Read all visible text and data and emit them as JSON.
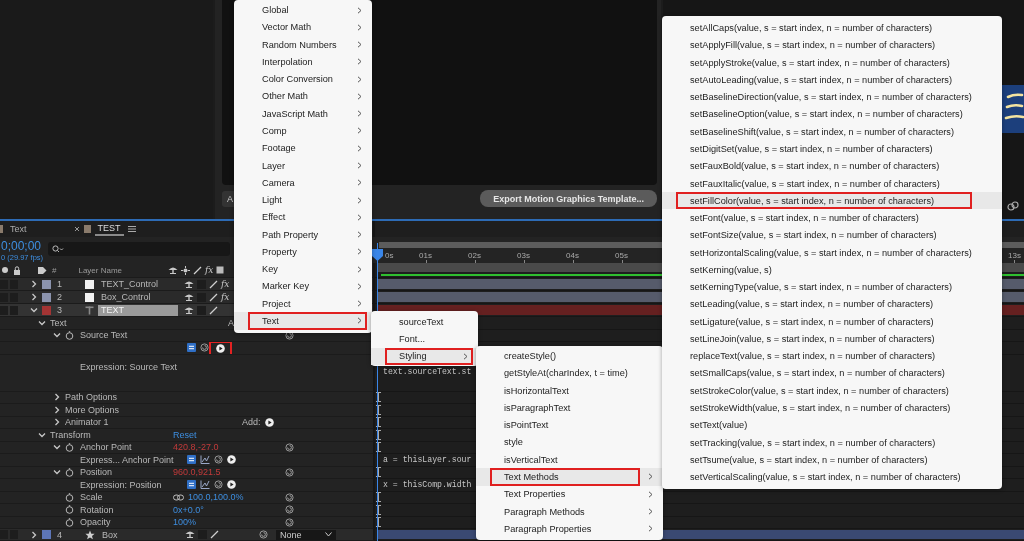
{
  "composition_panel": {
    "partial_button": "A",
    "export_button": "Export Motion Graphics Template..."
  },
  "timeline": {
    "tabs": [
      {
        "label": "Text",
        "selected": false,
        "closable": false
      },
      {
        "label": "TEST",
        "selected": true,
        "closable": true
      }
    ],
    "timecode": "0;00;00",
    "frame_rate": "0 (29.97 fps)",
    "columns": {
      "number": "#",
      "layer_name": "Layer Name",
      "effects": "fx"
    },
    "ruler": [
      "0s",
      "01s",
      "02s",
      "03s",
      "04s",
      "05s",
      "13s"
    ],
    "layers": [
      {
        "number": "1",
        "name": "TEXT_Control",
        "kind": "solid",
        "color": "#8b93ad",
        "selected": false,
        "expanded": false,
        "effects": "fx"
      },
      {
        "number": "2",
        "name": "Box_Control",
        "kind": "solid",
        "color": "#8b93ad",
        "selected": false,
        "expanded": false,
        "effects": "fx"
      },
      {
        "number": "3",
        "name": "TEXT",
        "kind": "text",
        "color": "#a33434",
        "selected": true,
        "expanded": true,
        "children": [
          {
            "label": "Text",
            "kind": "group",
            "expanded": true,
            "add_label": "A",
            "keyframe_marker": false,
            "children": [
              {
                "label": "Source Text",
                "kind": "property",
                "expanded": true,
                "keyframe_marker": false,
                "children": [
                  {
                    "label": "Expression: Source Text",
                    "kind": "expression_block",
                    "graph_button": false,
                    "annotated": true,
                    "code": "text.sourceText.st"
                  }
                ]
              },
              {
                "label": "Path Options",
                "kind": "group",
                "expanded": false,
                "keyframe_marker": true
              },
              {
                "label": "More Options",
                "kind": "group",
                "expanded": false,
                "keyframe_marker": true
              },
              {
                "label": "Animator 1",
                "kind": "group",
                "expanded": false,
                "add_label": "Add:",
                "keyframe_marker": true
              }
            ]
          },
          {
            "label": "Transform",
            "kind": "group",
            "expanded": true,
            "reset_link": "Reset",
            "keyframe_marker": true,
            "children": [
              {
                "label": "Anchor Point",
                "kind": "property",
                "expanded": true,
                "value": "420.8,-27.0",
                "has_expression": true,
                "keyframe_marker": true,
                "children": [
                  {
                    "label": "Express... Anchor Point",
                    "kind": "expression",
                    "graph_button": true,
                    "annotated": false,
                    "code": "a = thisLayer.sour"
                  }
                ]
              },
              {
                "label": "Position",
                "kind": "property",
                "expanded": true,
                "value": "960.0,921.5",
                "has_expression": true,
                "keyframe_marker": true,
                "children": [
                  {
                    "label": "Expression: Position",
                    "kind": "expression",
                    "graph_button": true,
                    "annotated": false,
                    "code": "x = thisComp.width"
                  }
                ]
              },
              {
                "label": "Scale",
                "kind": "property",
                "value": "100.0,100.0%",
                "has_expression": false,
                "linked": true,
                "keyframe_marker": true
              },
              {
                "label": "Rotation",
                "kind": "property",
                "value": "0x+0.0°",
                "has_expression": false,
                "keyframe_marker": true
              },
              {
                "label": "Opacity",
                "kind": "property",
                "value": "100%",
                "has_expression": false,
                "keyframe_marker": true
              }
            ]
          }
        ]
      },
      {
        "number": "4",
        "name": "Box",
        "kind": "shape",
        "color": "#5d76b8",
        "selected": false,
        "expanded": false,
        "parent": "None"
      }
    ]
  },
  "menus": [
    {
      "items": [
        {
          "label": "Global",
          "submenu": true,
          "selected": false
        },
        {
          "label": "Vector Math",
          "submenu": true,
          "selected": false
        },
        {
          "label": "Random Numbers",
          "submenu": true,
          "selected": false
        },
        {
          "label": "Interpolation",
          "submenu": true,
          "selected": false
        },
        {
          "label": "Color Conversion",
          "submenu": true,
          "selected": false
        },
        {
          "label": "Other Math",
          "submenu": true,
          "selected": false
        },
        {
          "label": "JavaScript Math",
          "submenu": true,
          "selected": false
        },
        {
          "label": "Comp",
          "submenu": true,
          "selected": false
        },
        {
          "label": "Footage",
          "submenu": true,
          "selected": false
        },
        {
          "label": "Layer",
          "submenu": true,
          "selected": false
        },
        {
          "label": "Camera",
          "submenu": true,
          "selected": false
        },
        {
          "label": "Light",
          "submenu": true,
          "selected": false
        },
        {
          "label": "Effect",
          "submenu": true,
          "selected": false
        },
        {
          "label": "Path Property",
          "submenu": true,
          "selected": false
        },
        {
          "label": "Property",
          "submenu": true,
          "selected": false
        },
        {
          "label": "Key",
          "submenu": true,
          "selected": false
        },
        {
          "label": "Marker Key",
          "submenu": true,
          "selected": false
        },
        {
          "label": "Project",
          "submenu": true,
          "selected": false
        },
        {
          "label": "Text",
          "submenu": true,
          "selected": true
        }
      ]
    },
    {
      "items": [
        {
          "label": "sourceText",
          "submenu": false,
          "selected": false
        },
        {
          "label": "Font...",
          "submenu": false,
          "selected": false
        },
        {
          "label": "Styling",
          "submenu": true,
          "selected": true
        }
      ]
    },
    {
      "items": [
        {
          "label": "createStyle()",
          "submenu": false,
          "selected": false
        },
        {
          "label": "getStyleAt(charIndex, t = time)",
          "submenu": false,
          "selected": false
        },
        {
          "label": "isHorizontalText",
          "submenu": false,
          "selected": false
        },
        {
          "label": "isParagraphText",
          "submenu": false,
          "selected": false
        },
        {
          "label": "isPointText",
          "submenu": false,
          "selected": false
        },
        {
          "label": "style",
          "submenu": false,
          "selected": false
        },
        {
          "label": "isVerticalText",
          "submenu": false,
          "selected": false
        },
        {
          "label": "Text Methods",
          "submenu": true,
          "selected": true
        },
        {
          "label": "Text Properties",
          "submenu": true,
          "selected": false
        },
        {
          "label": "Paragraph Methods",
          "submenu": true,
          "selected": false
        },
        {
          "label": "Paragraph Properties",
          "submenu": true,
          "selected": false
        }
      ]
    },
    {
      "items": [
        {
          "label": "setAllCaps(value, s = start index, n = number of characters)",
          "submenu": false,
          "selected": false
        },
        {
          "label": "setApplyFill(value, s = start index, n = number of characters)",
          "submenu": false,
          "selected": false
        },
        {
          "label": "setApplyStroke(value, s = start index, n = number of characters)",
          "submenu": false,
          "selected": false
        },
        {
          "label": "setAutoLeading(value, s = start index, n = number of characters)",
          "submenu": false,
          "selected": false
        },
        {
          "label": "setBaselineDirection(value, s = start index, n = number of characters)",
          "submenu": false,
          "selected": false
        },
        {
          "label": "setBaselineOption(value, s = start index, n = number of characters)",
          "submenu": false,
          "selected": false
        },
        {
          "label": "setBaselineShift(value, s = start index, n = number of characters)",
          "submenu": false,
          "selected": false
        },
        {
          "label": "setDigitSet(value, s = start index, n = number of characters)",
          "submenu": false,
          "selected": false
        },
        {
          "label": "setFauxBold(value, s = start index, n = number of characters)",
          "submenu": false,
          "selected": false
        },
        {
          "label": "setFauxItalic(value, s = start index, n = number of characters)",
          "submenu": false,
          "selected": false
        },
        {
          "label": "setFillColor(value, s = start index, n = number of characters)",
          "submenu": false,
          "selected": true
        },
        {
          "label": "setFont(value, s = start index, n = number of characters)",
          "submenu": false,
          "selected": false
        },
        {
          "label": "setFontSize(value, s = start index, n = number of characters)",
          "submenu": false,
          "selected": false
        },
        {
          "label": "setHorizontalScaling(value, s = start index, n = number of characters)",
          "submenu": false,
          "selected": false
        },
        {
          "label": "setKerning(value, s)",
          "submenu": false,
          "selected": false
        },
        {
          "label": "setKerningType(value, s = start index, n = number of characters)",
          "submenu": false,
          "selected": false
        },
        {
          "label": "setLeading(value, s = start index, n = number of characters)",
          "submenu": false,
          "selected": false
        },
        {
          "label": "setLigature(value, s = start index, n = number of characters)",
          "submenu": false,
          "selected": false
        },
        {
          "label": "setLineJoin(value, s = start index, n = number of characters)",
          "submenu": false,
          "selected": false
        },
        {
          "label": "replaceText(value, s = start index, n = number of characters)",
          "submenu": false,
          "selected": false
        },
        {
          "label": "setSmallCaps(value, s = start index, n = number of characters)",
          "submenu": false,
          "selected": false
        },
        {
          "label": "setStrokeColor(value, s = start index, n = number of characters)",
          "submenu": false,
          "selected": false
        },
        {
          "label": "setStrokeWidth(value, s = start index, n = number of characters)",
          "submenu": false,
          "selected": false
        },
        {
          "label": "setText(value)",
          "submenu": false,
          "selected": false
        },
        {
          "label": "setTracking(value, s = start index, n = number of characters)",
          "submenu": false,
          "selected": false
        },
        {
          "label": "setTsume(value, s = start index, n = number of characters)",
          "submenu": false,
          "selected": false
        },
        {
          "label": "setVerticalScaling(value, s = start index, n = number of characters)",
          "submenu": false,
          "selected": false
        }
      ]
    }
  ]
}
